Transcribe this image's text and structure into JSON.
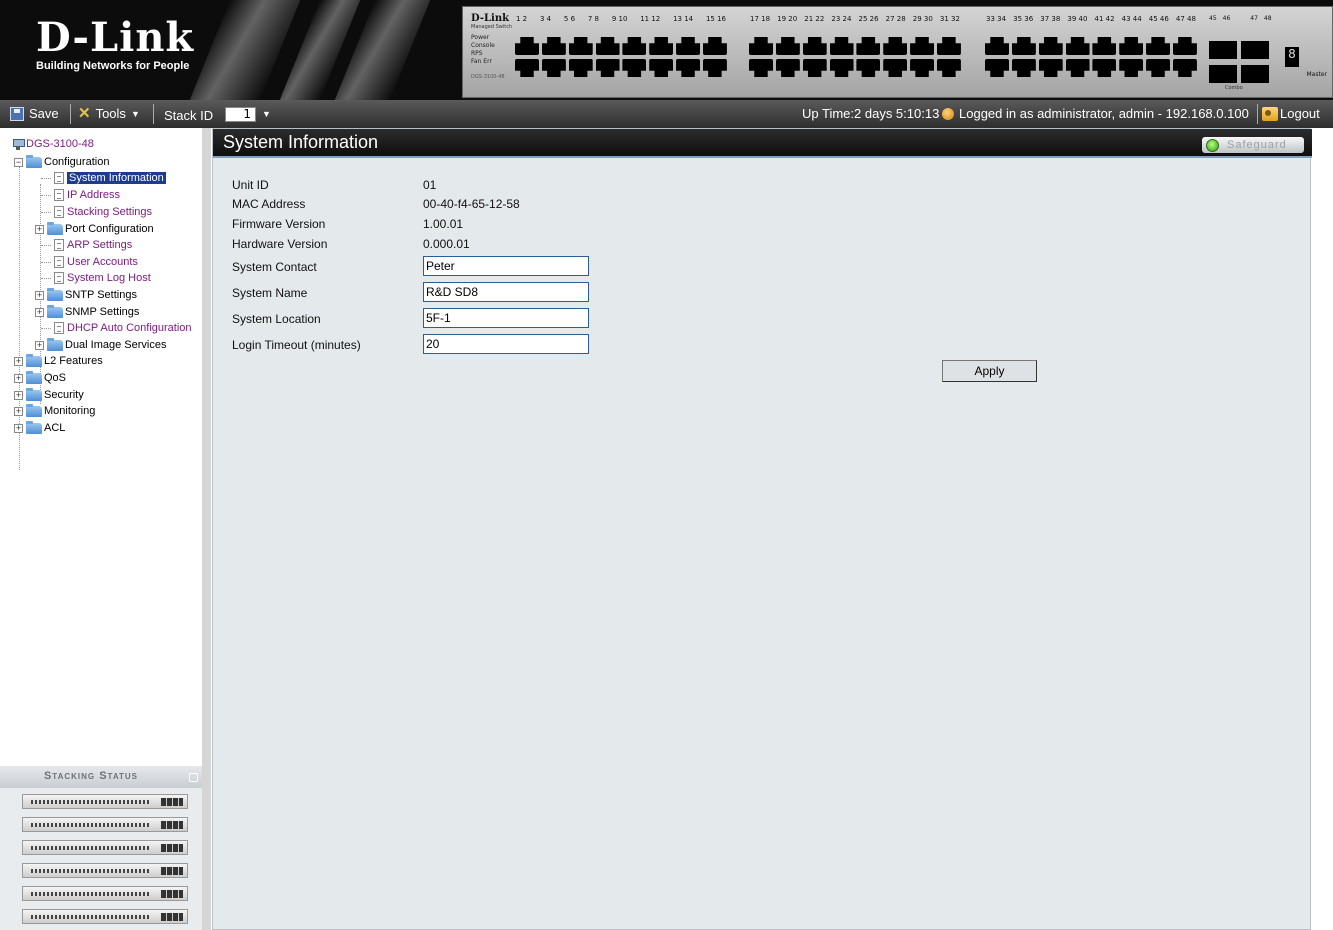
{
  "brand": {
    "name": "D-Link",
    "tagline": "Building Networks for People"
  },
  "device": {
    "brand": "D-Link",
    "subtitle": "Managed Switch",
    "leds": [
      "Power",
      "Console",
      "RPS",
      "Fan Err"
    ],
    "model": "DGS-3100-48",
    "port_groups": [
      [
        "1",
        "2",
        "3",
        "4",
        "5",
        "6",
        "7",
        "8",
        "9",
        "10",
        "11",
        "12",
        "13",
        "14",
        "15",
        "16"
      ],
      [
        "17",
        "18",
        "19",
        "20",
        "21",
        "22",
        "23",
        "24",
        "25",
        "26",
        "27",
        "28",
        "29",
        "30",
        "31",
        "32"
      ],
      [
        "33",
        "34",
        "35",
        "36",
        "37",
        "38",
        "39",
        "40",
        "41",
        "42",
        "43",
        "44",
        "45",
        "46",
        "47",
        "48"
      ]
    ],
    "combo_ports": [
      "45",
      "46",
      "47",
      "48"
    ],
    "combo_label": "Combo",
    "master_label": "Master",
    "unit_display": "8"
  },
  "toolbar": {
    "save_label": "Save",
    "tools_label": "Tools",
    "stack_id_label": "Stack ID",
    "stack_id_value": "1",
    "uptime": "Up Time:2 days 5:10:13",
    "login_info": "Logged in as administrator, admin - 192.168.0.100",
    "logout_label": "Logout"
  },
  "nav": {
    "root": "DGS-3100-48",
    "configuration": "Configuration",
    "items": {
      "system_information": "System Information",
      "ip_address": "IP Address",
      "stacking_settings": "Stacking Settings",
      "port_configuration": "Port Configuration",
      "arp_settings": "ARP Settings",
      "user_accounts": "User Accounts",
      "system_log_host": "System Log Host",
      "sntp_settings": "SNTP Settings",
      "snmp_settings": "SNMP Settings",
      "dhcp_auto_configuration": "DHCP Auto Configuration",
      "dual_image_services": "Dual Image Services"
    },
    "top": {
      "l2_features": "L2 Features",
      "qos": "QoS",
      "security": "Security",
      "monitoring": "Monitoring",
      "acl": "ACL"
    }
  },
  "stacking_status": {
    "title": "Stacking Status",
    "unit_count": 6
  },
  "main": {
    "title": "System Information",
    "safeguard_label": "Safeguard",
    "safeguard_status_color": "#2d9b12",
    "fields": {
      "unit_id": {
        "label": "Unit ID",
        "value": "01"
      },
      "mac": {
        "label": "MAC Address",
        "value": "00-40-f4-65-12-58"
      },
      "firmware": {
        "label": "Firmware Version",
        "value": "1.00.01"
      },
      "hardware": {
        "label": "Hardware Version",
        "value": "0.000.01"
      },
      "contact": {
        "label": "System Contact",
        "value": "Peter"
      },
      "name": {
        "label": "System Name",
        "value": "R&D SD8"
      },
      "location": {
        "label": "System Location",
        "value": "5F-1"
      },
      "timeout": {
        "label": "Login Timeout (minutes)",
        "value": "20"
      }
    },
    "apply_label": "Apply"
  },
  "colors": {
    "header_bg": "#0c0c0c",
    "toolbar_bg": "#3a3a3a",
    "nav_selected": "#1d3c8f",
    "nav_link": "#7b1d82",
    "content_bg": "#e4e9ec",
    "title_bar": "#111111"
  }
}
